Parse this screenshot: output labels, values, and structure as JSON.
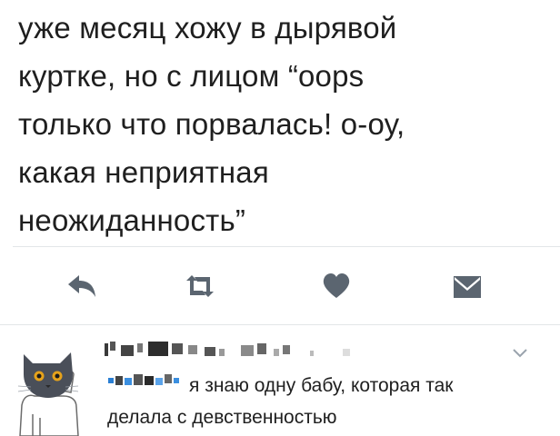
{
  "tweet": {
    "lines": [
      "уже месяц хожу в дырявой",
      "куртке, но с лицом “oops",
      "только что порвалась! о-оу,",
      "какая неприятная",
      "неожиданность”"
    ]
  },
  "actions": {
    "reply_icon": "reply-arrow-icon",
    "retweet_icon": "retweet-icon",
    "like_icon": "heart-icon",
    "dm_icon": "envelope-icon"
  },
  "reply": {
    "avatar_icon": "cat-avatar",
    "menu_icon": "chevron-down-icon",
    "text_line1": "я знаю одну бабу, которая так",
    "text_line2": "делала с девственностью"
  },
  "colors": {
    "text": "#1f1f1f",
    "icon": "#5b6570",
    "divider": "#e3e6e8"
  }
}
